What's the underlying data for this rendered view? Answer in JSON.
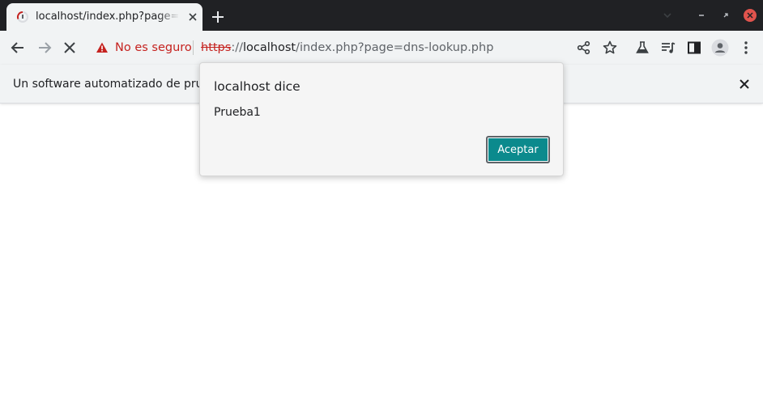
{
  "browser": {
    "tab": {
      "title": "localhost/index.php?page=dns-lookup.php",
      "favicon": "loading-spinner-icon",
      "close_icon": "close-icon"
    },
    "new_tab_icon": "plus-icon",
    "window_controls": [
      "tab-search-icon",
      "minimize-icon",
      "maximize-icon",
      "close-window-icon"
    ]
  },
  "toolbar": {
    "back_icon": "back-arrow-icon",
    "forward_icon": "forward-arrow-icon",
    "stop_icon": "stop-loading-icon",
    "security_icon": "warning-triangle-icon",
    "security_label": "No es seguro",
    "url": {
      "scheme": "https",
      "separator": "://",
      "host": "localhost",
      "path": "/index.php?page=dns-lookup.php"
    },
    "right_icons": [
      "share-icon",
      "bookmark-star-icon",
      "labs-flask-icon",
      "media-queue-icon",
      "side-panel-icon",
      "profile-avatar-icon",
      "kebab-menu-icon"
    ]
  },
  "infobar": {
    "text": "Un software automatizado de prueba está controlando Chrome.",
    "close_icon": "close-icon"
  },
  "dialog": {
    "title": "localhost dice",
    "message": "Prueba1",
    "ok_label": "Aceptar"
  },
  "colors": {
    "titlebar": "#202124",
    "toolbar": "#f1f3f4",
    "warning": "#c5221f",
    "button": "#0b8a8d",
    "window_close": "#e0534d"
  }
}
